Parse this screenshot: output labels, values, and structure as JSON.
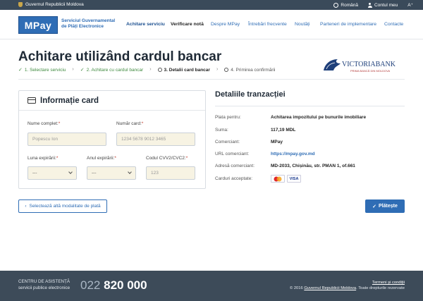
{
  "govbar": {
    "gov_name": "Guvernul Republicii Moldova",
    "language": "Română",
    "account": "Contul meu",
    "font_size": "A⁺"
  },
  "header": {
    "logo": "MPay",
    "logo_caption": "Serviciul Guvernamental de Plăți Electronice",
    "nav": [
      "Achitare serviciu",
      "Verificare notă",
      "Despre MPay",
      "Întrebări frecvente",
      "Noutăți",
      "Parteneri de implementare",
      "Contacte"
    ]
  },
  "page": {
    "title": "Achitare utilizând cardul bancar",
    "steps": [
      "1. Selectare serviciu",
      "2. Achitare cu cardul bancar",
      "3. Detalii card bancar",
      "4. Primirea confirmării"
    ],
    "bank_name": "VICTORIABANK",
    "bank_tagline": "PRIMA BANCĂ DIN MOLDOVA"
  },
  "card_form": {
    "title": "Informație card",
    "name_label": "Nume complet:",
    "name_placeholder": "Popescu Ion",
    "number_label": "Număr card:",
    "number_placeholder": "1234 5678 9012 3465",
    "month_label": "Luna expirării:",
    "month_value": "---",
    "year_label": "Anul expirării:",
    "year_value": "---",
    "cvv_label": "Codul CVV2/CVC2:",
    "cvv_placeholder": "123",
    "required_mark": "*"
  },
  "details": {
    "title": "Detaliile tranzacției",
    "rows": [
      {
        "label": "Plata pentru:",
        "value": "Achitarea impozitului pe bunurile imobiliare"
      },
      {
        "label": "Suma:",
        "value": "117,19 MDL"
      },
      {
        "label": "Comerciant:",
        "value": "MPay"
      },
      {
        "label": "URL comerciant:",
        "value": "https://mpay.gov.md"
      },
      {
        "label": "Adresă comerciant:",
        "value": "MD-2033, Chișinău, str. PMAN 1, of.661"
      },
      {
        "label": "Carduri acceptate:",
        "value": ""
      }
    ],
    "cards": [
      "MasterCard",
      "VISA"
    ]
  },
  "actions": {
    "back": "Selectează altă modalitate de plată",
    "pay": "Plătește"
  },
  "footer": {
    "center_line1": "CENTRU DE ASISTENȚĂ",
    "center_line2": "servicii publice electronice",
    "phone_prefix": "022",
    "phone_number": "820 000",
    "terms": "Termeni și condiții",
    "copyright_prefix": "© 2016",
    "copyright_org": "Guvernul Republicii Moldova",
    "copyright_suffix": ". Toate drepturile rezervate"
  },
  "colors": {
    "primary": "#2f6db5",
    "govbar": "#3a4a5a",
    "footer": "#3d4b59",
    "input_bg": "#f7f3e3",
    "done_step": "#3f8a3f"
  }
}
